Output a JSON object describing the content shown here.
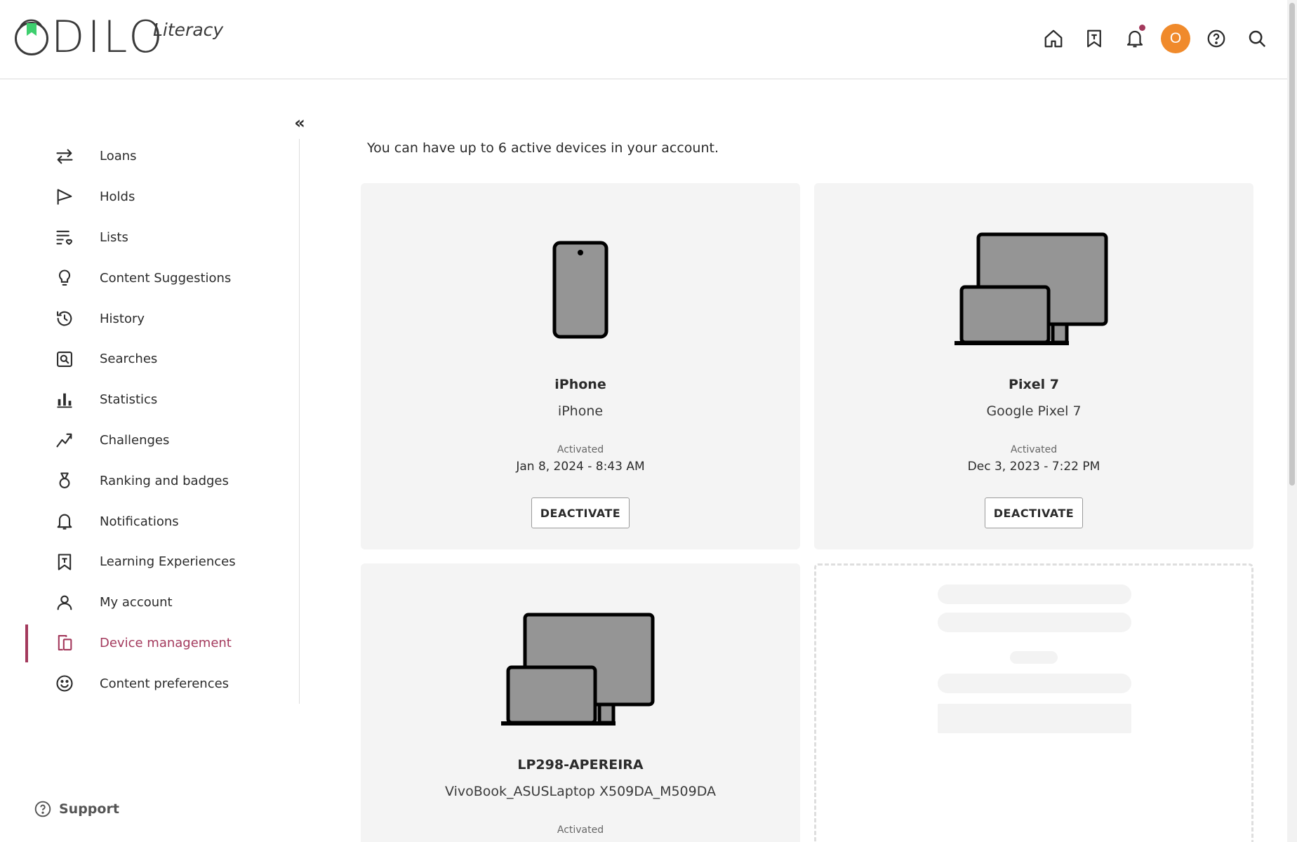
{
  "header": {
    "logo_text": "ODILO",
    "logo_sub": "Literacy",
    "icons": [
      "home-icon",
      "bookmark-icon",
      "bell-icon",
      "avatar",
      "help-icon",
      "search-icon"
    ],
    "avatar_letter": "O"
  },
  "sidebar": {
    "items": [
      {
        "label": "Loans",
        "icon": "swap-arrows-icon"
      },
      {
        "label": "Holds",
        "icon": "flag-icon"
      },
      {
        "label": "Lists",
        "icon": "list-heart-icon"
      },
      {
        "label": "Content Suggestions",
        "icon": "lightbulb-icon"
      },
      {
        "label": "History",
        "icon": "history-icon"
      },
      {
        "label": "Searches",
        "icon": "search-box-icon"
      },
      {
        "label": "Statistics",
        "icon": "bar-chart-icon"
      },
      {
        "label": "Challenges",
        "icon": "trend-icon"
      },
      {
        "label": "Ranking and badges",
        "icon": "medal-icon"
      },
      {
        "label": "Notifications",
        "icon": "bell-icon"
      },
      {
        "label": "Learning Experiences",
        "icon": "bookmark-badge-icon"
      },
      {
        "label": "My account",
        "icon": "user-icon"
      },
      {
        "label": "Device management",
        "icon": "devices-icon"
      },
      {
        "label": "Content preferences",
        "icon": "smiley-icon"
      }
    ],
    "active": "Device management",
    "support_label": "Support"
  },
  "main": {
    "intro": "You can have up to 6 active devices in your account.",
    "devices": [
      {
        "name": "iPhone",
        "model": "iPhone",
        "activated_label": "Activated",
        "date": "Jan 8, 2024 - 8:43 AM",
        "button": "DEACTIVATE",
        "icon": "phone-icon"
      },
      {
        "name": "Pixel 7",
        "model": "Google Pixel 7",
        "activated_label": "Activated",
        "date": "Dec 3, 2023 - 7:22 PM",
        "button": "DEACTIVATE",
        "icon": "desktop-laptop-icon"
      },
      {
        "name": "LP298-APEREIRA",
        "model": "VivoBook_ASUSLaptop X509DA_M509DA",
        "activated_label": "Activated",
        "icon": "desktop-laptop-icon"
      }
    ]
  },
  "colors": {
    "accent": "#a3395c",
    "avatar": "#f08a2b",
    "card_bg": "#f4f4f4",
    "logo_flag": "#3ecf6e"
  }
}
